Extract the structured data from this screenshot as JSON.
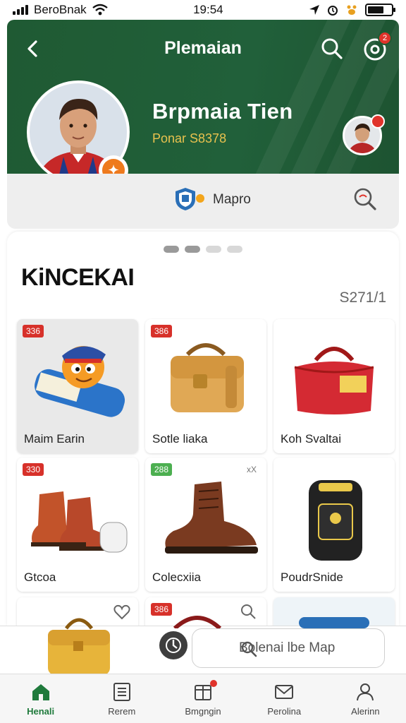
{
  "status_bar": {
    "carrier": "BeroBnak",
    "time": "19:54"
  },
  "header": {
    "title": "Plemaian",
    "name": "Brpmaia Tien",
    "subtitle": "Ponar S8378",
    "notification_count": "2"
  },
  "sub_bar": {
    "label": "Mapro"
  },
  "section": {
    "title": "KiNCEKAI",
    "amount": "S271/1"
  },
  "products": [
    {
      "tag": "336",
      "tag_color": "#d7312a",
      "name": "Maim Earin",
      "icon": "mascot-plush-icon"
    },
    {
      "tag": "386",
      "tag_color": "#d7312a",
      "name": "Sotle liaka",
      "icon": "leather-bag-icon"
    },
    {
      "tag": "",
      "tag_color": "",
      "name": "Koh Svaltai",
      "icon": "red-duffel-bag-icon"
    },
    {
      "tag": "330",
      "tag_color": "#d7312a",
      "name": "Gtcoa",
      "icon": "boots-pair-icon"
    },
    {
      "tag": "288",
      "tag_color": "#4caf50",
      "name": "Colecxiia",
      "icon": "brown-boot-icon",
      "tag_extra": "xX"
    },
    {
      "tag": "",
      "tag_color": "",
      "name": "PoudrSnide",
      "icon": "backpack-icon"
    }
  ],
  "peek_tag": "386",
  "search": {
    "placeholder": "Bolenai lbe Map"
  },
  "bottom_nav": [
    {
      "label": "Henali",
      "icon": "home-icon",
      "active": true
    },
    {
      "label": "Rerem",
      "icon": "list-icon"
    },
    {
      "label": "Bmgngin",
      "icon": "box-icon"
    },
    {
      "label": "Perolina",
      "icon": "mail-icon"
    },
    {
      "label": "Alerinn",
      "icon": "profile-icon"
    }
  ],
  "colors": {
    "header_green": "#1f5a33",
    "accent_orange": "#ee7a1d",
    "badge_red": "#e0332b",
    "tag_green": "#4caf50"
  }
}
